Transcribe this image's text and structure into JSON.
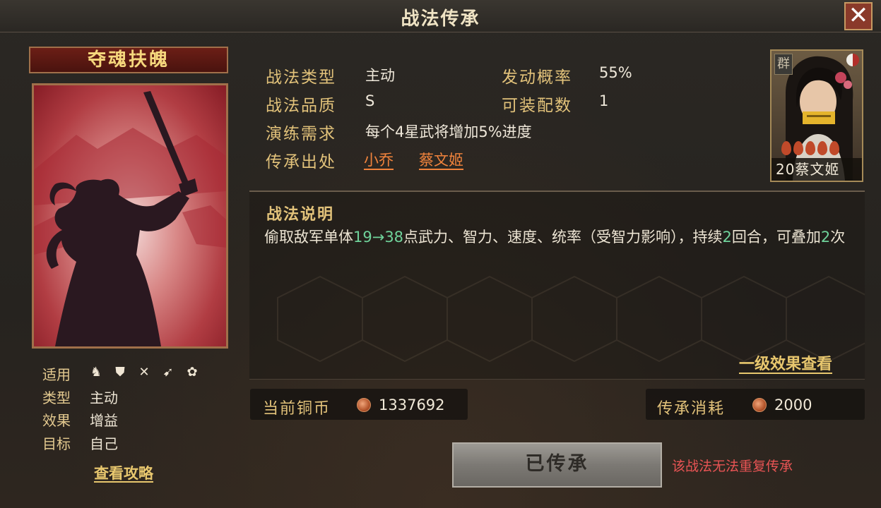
{
  "window": {
    "title": "战法传承",
    "close_label": "✕"
  },
  "skill": {
    "name": "夺魂扶魄",
    "info": [
      {
        "label": "适用",
        "value": ""
      },
      {
        "label": "类型",
        "value": "主动"
      },
      {
        "label": "效果",
        "value": "增益"
      },
      {
        "label": "目标",
        "value": "自己"
      }
    ],
    "suitable_icons": [
      "cavalry-icon",
      "shield-icon",
      "crossed-bows-icon",
      "spear-icon",
      "wheel-icon"
    ],
    "view_guide_label": "查看攻略"
  },
  "attributes": {
    "type_label": "战法类型",
    "type_value": "主动",
    "rate_label": "发动概率",
    "rate_value": "55%",
    "quality_label": "战法品质",
    "quality_value": "S",
    "equip_label": "可装配数",
    "equip_value": "1",
    "train_label": "演练需求",
    "train_value": "每个4星武将增加5%进度",
    "source_label": "传承出处",
    "source_links": [
      "小乔",
      "蔡文姬"
    ]
  },
  "hero": {
    "faction": "群",
    "level_name": "20蔡文姬",
    "stars": 5
  },
  "description": {
    "title": "战法说明",
    "parts": [
      {
        "text": "偷取敌军单体",
        "highlight": false
      },
      {
        "text": "19→38",
        "highlight": true
      },
      {
        "text": "点武力、智力、速度、统率（受智力影响），持续",
        "highlight": false
      },
      {
        "text": "2",
        "highlight": true
      },
      {
        "text": "回合，可叠加",
        "highlight": false
      },
      {
        "text": "2",
        "highlight": true
      },
      {
        "text": "次",
        "highlight": false
      }
    ],
    "level1_link": "一级效果查看"
  },
  "coins": {
    "current_label": "当前铜币",
    "current_value": "1337692",
    "cost_label": "传承消耗",
    "cost_value": "2000"
  },
  "inherit": {
    "button_label": "已传承",
    "warning": "该战法无法重复传承"
  },
  "colors": {
    "accent_gold": "#e2c27a",
    "highlight_green": "#6fd29a",
    "link_orange": "#f0833c",
    "warning_red": "#e85454"
  }
}
